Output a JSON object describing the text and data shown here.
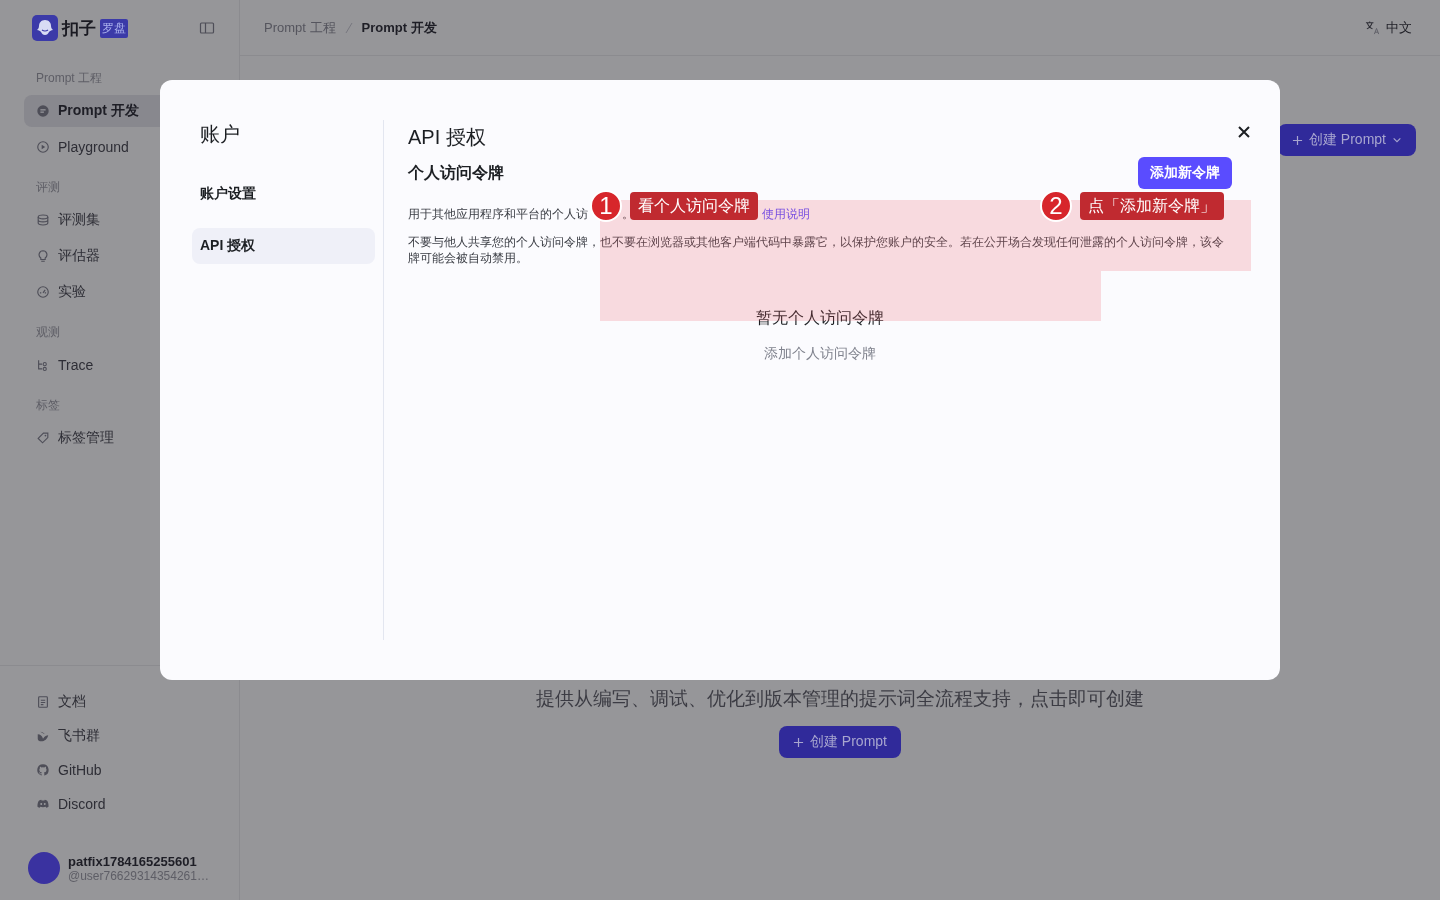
{
  "app": {
    "logo_text": "扣子",
    "logo_badge": "罗盘"
  },
  "breadcrumb": [
    {
      "label": "Prompt 工程",
      "current": false
    },
    {
      "label": "Prompt 开发",
      "current": true
    }
  ],
  "language": "中文",
  "sidebar": {
    "sections": [
      {
        "title": "Prompt 工程",
        "items": [
          {
            "label": "Prompt 开发",
            "selected": true
          },
          {
            "label": "Playground",
            "selected": false
          }
        ]
      },
      {
        "title": "评测",
        "items": [
          {
            "label": "评测集",
            "selected": false
          },
          {
            "label": "评估器",
            "selected": false
          },
          {
            "label": "实验",
            "selected": false
          }
        ]
      },
      {
        "title": "观测",
        "items": [
          {
            "label": "Trace",
            "selected": false
          }
        ]
      },
      {
        "title": "标签",
        "items": [
          {
            "label": "标签管理",
            "selected": false
          }
        ]
      }
    ],
    "footer_items": [
      {
        "label": "文档"
      },
      {
        "label": "飞书群"
      },
      {
        "label": "GitHub"
      },
      {
        "label": "Discord"
      }
    ],
    "user": {
      "name": "patfix1784165255601",
      "handle": "@user76629314354261…"
    }
  },
  "main": {
    "create_button": "创建 Prompt",
    "empty_text": "提供从编写、调试、优化到版本管理的提示词全流程支持，点击即可创建",
    "empty_button": "创建 Prompt"
  },
  "dialog": {
    "title": "账户",
    "nav": [
      {
        "label": "账户设置",
        "selected": false
      },
      {
        "label": "API 授权",
        "selected": true
      }
    ],
    "heading": "API 授权",
    "subheading": "个人访问令牌",
    "add_button": "添加新令牌",
    "intro": {
      "text": "用于其他应用程序和平台的个人访",
      "after": "。",
      "link": "使用说明"
    },
    "warning": "不要与他人共享您的个人访问令牌，也不要在浏览器或其他客户端代码中暴露它，以保护您账户的安全。若在公开场合发现任何泄露的个人访问令牌，该令牌可能会被自动禁用。",
    "empty_title": "暂无个人访问令牌",
    "empty_action": "添加个人访问令牌"
  },
  "annotations": [
    {
      "number": "1",
      "text": "看个人访问令牌"
    },
    {
      "number": "2",
      "text": "点「添加新令牌」"
    }
  ]
}
